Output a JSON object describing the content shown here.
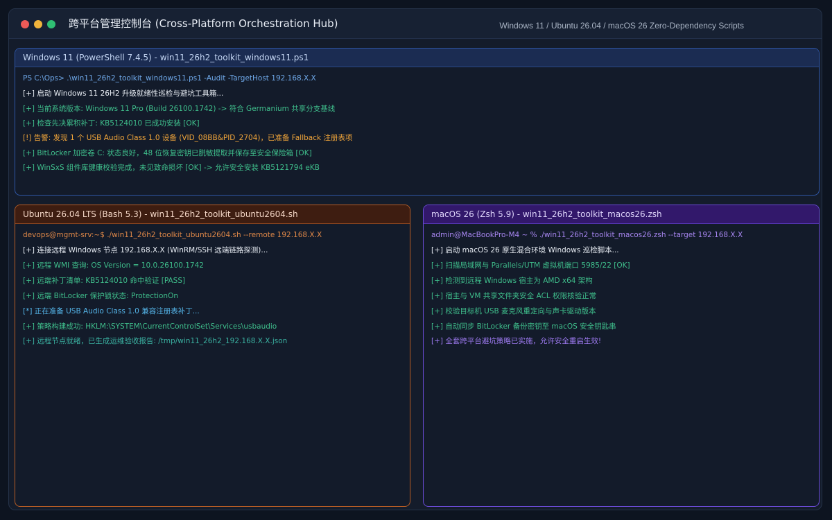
{
  "window": {
    "title": "跨平台管理控制台 (Cross-Platform Orchestration Hub)",
    "subtitle": "Windows 11 / Ubuntu 26.04 / macOS 26 Zero-Dependency Scripts"
  },
  "colors": {
    "close": "#ed5a57",
    "minimize": "#f0b43c",
    "maximize": "#2fbf73",
    "windows_accent": "#2f56a6",
    "ubuntu_accent": "#b85d25",
    "macos_accent": "#6a4bd6"
  },
  "panels": {
    "windows": {
      "header": "Windows 11 (PowerShell 7.4.5) - win11_26h2_toolkit_windows11.ps1",
      "prompt": "PS C:\\Ops> .\\win11_26h2_toolkit_windows11.ps1 -Audit -TargetHost 192.168.X.X",
      "lines": [
        "[+] 启动 Windows 11 26H2 升级就绪性巡检与避坑工具箱...",
        "[+] 当前系统版本: Windows 11 Pro (Build 26100.1742) -> 符合 Germanium 共享分支基线",
        "[+] 检查先决累积补丁: KB5124010 已成功安装 [OK]",
        "[!] 告警: 发现 1 个 USB Audio Class 1.0 设备 (VID_08BB&PID_2704)，已准备 Fallback 注册表项",
        "[+] BitLocker 加密卷 C: 状态良好，48 位恢复密钥已脱敏提取并保存至安全保险箱 [OK]",
        "[+] WinSxS 组件库健康校验完成，未见致命损坏 [OK] -> 允许安全安装 KB5121794 eKB"
      ]
    },
    "ubuntu": {
      "header": "Ubuntu 26.04 LTS (Bash 5.3) - win11_26h2_toolkit_ubuntu2604.sh",
      "prompt": "devops@mgmt-srv:~$ ./win11_26h2_toolkit_ubuntu2604.sh --remote 192.168.X.X",
      "lines": [
        "[+] 连接远程 Windows 节点 192.168.X.X (WinRM/SSH 远端链路探测)...",
        "[+] 远程 WMI 查询: OS Version = 10.0.26100.1742",
        "[+] 远端补丁清单: KB5124010 命中验证 [PASS]",
        "[+] 远端 BitLocker 保护锁状态: ProtectionOn",
        "[*] 正在准备 USB Audio Class 1.0 兼容注册表补丁...",
        "[+] 策略构建成功: HKLM:\\SYSTEM\\CurrentControlSet\\Services\\usbaudio",
        "[+] 远程节点就绪，已生成运维验收报告: /tmp/win11_26h2_192.168.X.X.json"
      ]
    },
    "macos": {
      "header": "macOS 26 (Zsh 5.9) - win11_26h2_toolkit_macos26.zsh",
      "prompt": "admin@MacBookPro-M4 ~ % ./win11_26h2_toolkit_macos26.zsh --target 192.168.X.X",
      "lines": [
        "[+] 启动 macOS 26 原生混合环境 Windows 巡检脚本...",
        "[+] 扫描局域网与 Parallels/UTM 虚拟机端口 5985/22 [OK]",
        "[+] 检测到远程 Windows 宿主为 AMD x64 架构",
        "[+] 宿主与 VM 共享文件夹安全 ACL 权限核验正常",
        "[+] 校验目标机 USB 麦克风重定向与声卡驱动版本",
        "[+] 自动同步 BitLocker 备份密钥至 macOS 安全钥匙串",
        "[+] 全套跨平台避坑策略已实施，允许安全重启生效!"
      ]
    }
  }
}
